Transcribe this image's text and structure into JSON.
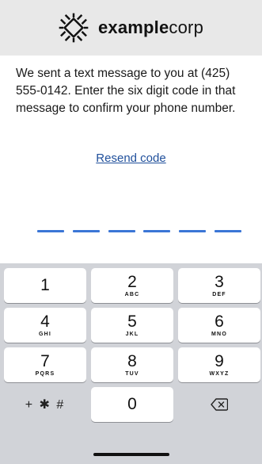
{
  "header": {
    "brand_bold": "example",
    "brand_light": "corp",
    "logo_icon": "chip-outline-icon",
    "background": "#e8e8e8"
  },
  "message": {
    "text": "We sent a text message to you at (425) 555-0142. Enter the six digit code in that message to confirm your phone number."
  },
  "resend": {
    "label": "Resend code",
    "color": "#1f4f9b"
  },
  "code": {
    "length": 6,
    "filled": 0,
    "slot_color": "#3b76d6"
  },
  "keypad": {
    "keys": [
      {
        "num": "1",
        "letters": ""
      },
      {
        "num": "2",
        "letters": "ABC"
      },
      {
        "num": "3",
        "letters": "DEF"
      },
      {
        "num": "4",
        "letters": "GHI"
      },
      {
        "num": "5",
        "letters": "JKL"
      },
      {
        "num": "6",
        "letters": "MNO"
      },
      {
        "num": "7",
        "letters": "PQRS"
      },
      {
        "num": "8",
        "letters": "TUV"
      },
      {
        "num": "9",
        "letters": "WXYZ"
      }
    ],
    "symbols_label": "+ ✱ #",
    "zero": "0",
    "backspace_icon": "backspace-icon",
    "background": "#d1d3d8"
  }
}
